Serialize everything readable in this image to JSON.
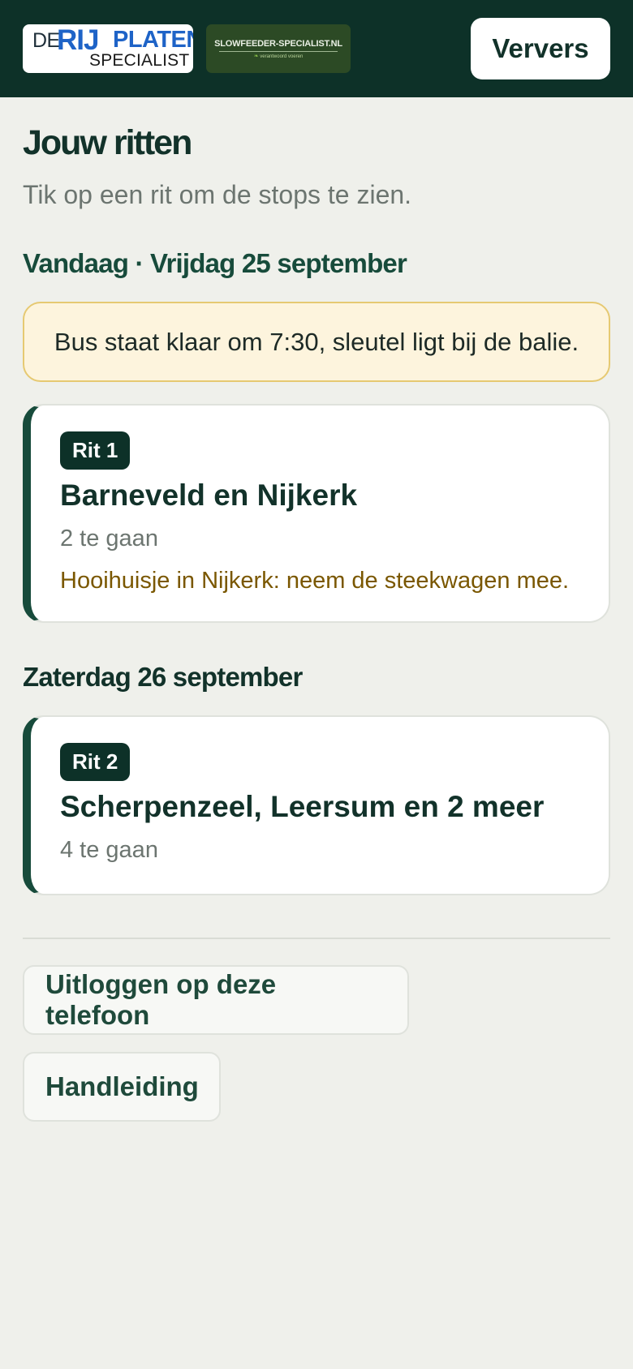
{
  "header": {
    "logo_primary": {
      "de": "DE",
      "rij": "RIJ",
      "platen": "PLATEN",
      "specialist": "SPECIALIST"
    },
    "logo_secondary": {
      "name": "SLOWFEEDER-SPECIALIST.NL",
      "tagline": "verantwoord voeren"
    },
    "refresh_label": "Ververs"
  },
  "page": {
    "title": "Jouw ritten",
    "subtitle": "Tik op een rit om de stops te zien."
  },
  "days": [
    {
      "heading": "Vandaag · Vrijdag 25 september",
      "notice": "Bus staat klaar om 7:30, sleutel ligt bij de balie.",
      "rides": [
        {
          "badge": "Rit 1",
          "title": "Barneveld en Nijkerk",
          "remaining": "2 te gaan",
          "note": "Hooihuisje in Nijkerk: neem de steekwagen mee."
        }
      ]
    },
    {
      "heading": "Zaterdag 26 september",
      "rides": [
        {
          "badge": "Rit 2",
          "title": "Scherpenzeel, Leersum en 2 meer",
          "remaining": "4 te gaan"
        }
      ]
    }
  ],
  "footer": {
    "logout_label": "Uitloggen op deze telefoon",
    "manual_label": "Handleiding"
  },
  "colors": {
    "header_bg": "#0d3128",
    "accent": "#174b3b",
    "notice_bg": "#fdf4dd",
    "note_text": "#7a5700"
  }
}
